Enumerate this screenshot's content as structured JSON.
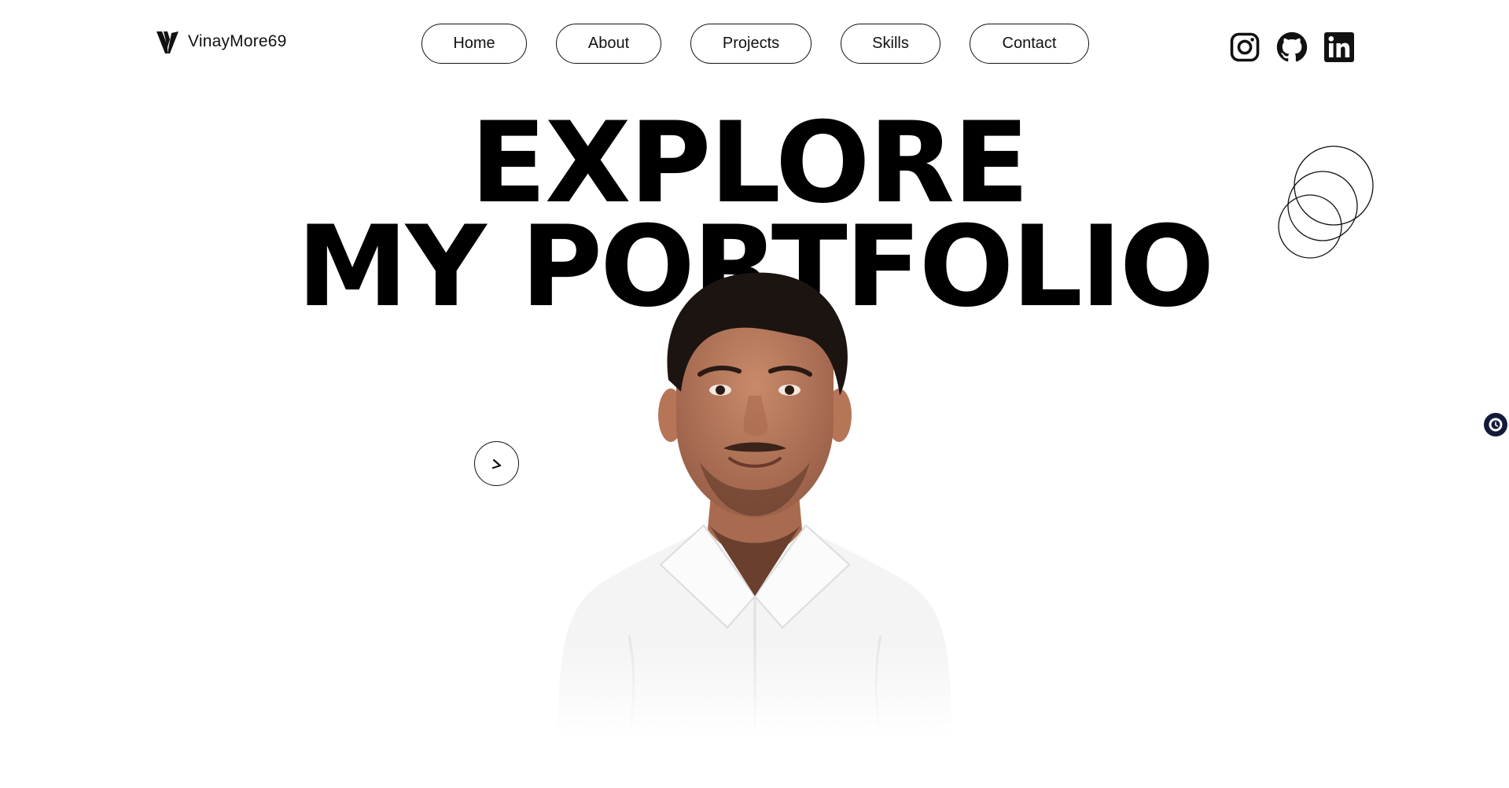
{
  "brand": {
    "name": "VinayMore69",
    "logo_icon": "v-logo-icon"
  },
  "nav": {
    "home": "Home",
    "about": "About",
    "projects": "Projects",
    "skills": "Skills",
    "contact": "Contact"
  },
  "socials": [
    "instagram-icon",
    "github-icon",
    "linkedin-icon"
  ],
  "hero": {
    "line1": "EXPLORE",
    "line2": "MY PORTFOLIO"
  },
  "colors": {
    "text": "#000000",
    "background": "#ffffff",
    "widget": "#141a3a"
  }
}
